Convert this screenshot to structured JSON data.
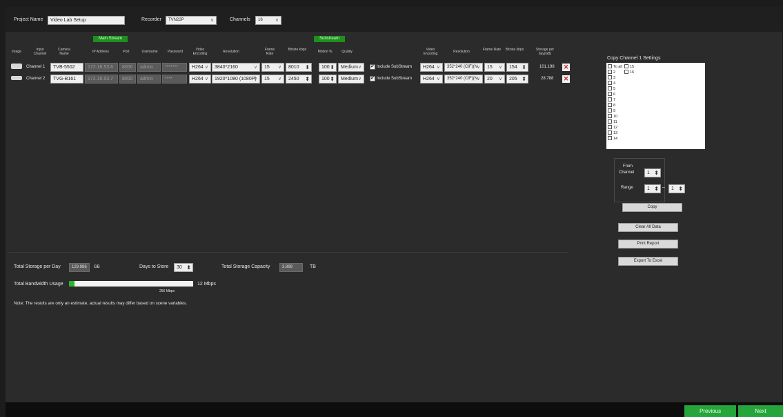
{
  "header": {
    "project_label": "Project Name",
    "project_value": "Video Lab Setup",
    "recorder_label": "Recorder",
    "recorder_value": "TVN22P",
    "channels_label": "Channels",
    "channels_value": "16"
  },
  "sections": {
    "main_stream": "Main Stream",
    "substream": "Substream"
  },
  "columns": {
    "image": "Image",
    "input_channel": "Input Channel",
    "camera_name": "Camera Name",
    "ip_address": "IP Address",
    "port": "Port",
    "username": "Username",
    "password": "Password",
    "video_encoding": "Video Encoding",
    "resolution": "Resolution",
    "frame_rate": "Frame Rate",
    "bitrate": "Bitrate kbps",
    "motion": "Motion %",
    "quality": "Quality",
    "sub_video_encoding": "Video Encoding",
    "sub_resolution": "Resolution",
    "sub_frame_rate": "Frame Rate",
    "sub_bitrate": "Bitrate kbps",
    "storage": "Storage per day(GB)"
  },
  "rows": [
    {
      "channel": "Channel 1",
      "camera": "TVB-5502",
      "ip": "172.16.53.6",
      "port": "8000",
      "username": "admin",
      "password": "*******",
      "encoding": "H264",
      "resolution": "3840*2160",
      "frame_rate": "15",
      "bitrate": "8010",
      "motion": "100",
      "quality": "Medium",
      "include_sub": "Include SubStream",
      "sub_encoding": "H264",
      "sub_resolution": "352*240 (CIF)(N",
      "sub_frame_rate": "15",
      "sub_bitrate": "154",
      "storage": "101.198"
    },
    {
      "channel": "Channel 2",
      "camera": "TVG-B161",
      "ip": "172.16.53.7",
      "port": "8000",
      "username": "admin",
      "password": "****",
      "encoding": "H264",
      "resolution": "1920*1080 (1080P)",
      "frame_rate": "15",
      "bitrate": "2450",
      "motion": "100",
      "quality": "Medium",
      "include_sub": "Include SubStream",
      "sub_encoding": "H264",
      "sub_resolution": "352*240 (CIF)(N",
      "sub_frame_rate": "20",
      "sub_bitrate": "205",
      "storage": "28.788"
    }
  ],
  "copy_panel": {
    "title": "Copy Channel 1 Settings",
    "list": [
      "To all",
      "2",
      "3",
      "4",
      "5",
      "6",
      "7",
      "8",
      "9",
      "10",
      "11",
      "12",
      "13",
      "14"
    ],
    "list_col2": [
      "15",
      "16"
    ],
    "from_label": "From",
    "channel_label": "Channel",
    "from_value": "1",
    "range_label": "Range",
    "range_from": "1",
    "range_dash": "–",
    "range_to": "1",
    "copy_button": "Copy",
    "clear_button": "Clear All Data",
    "print_button": "Print Report",
    "export_button": "Export To Excel"
  },
  "summary": {
    "storage_label": "Total Storage per Day",
    "storage_value": "129.986",
    "storage_unit": "GB",
    "days_label": "Days to Store",
    "days_value": "30",
    "capacity_label": "Total Storage Capacity",
    "capacity_value": "3.899",
    "capacity_unit": "TB",
    "bandwidth_label": "Total Bandwidth Usage",
    "bandwidth_value": "12 Mbps",
    "bandwidth_max": "256 Mbps",
    "bandwidth_fraction": 0.047,
    "note": "Note: The results are only an estimate, actual results may differ based on scene variables."
  },
  "nav": {
    "previous": "Previous",
    "next": "Next"
  },
  "colors": {
    "accent_green": "#25a53a",
    "delete_red": "#d02020"
  }
}
